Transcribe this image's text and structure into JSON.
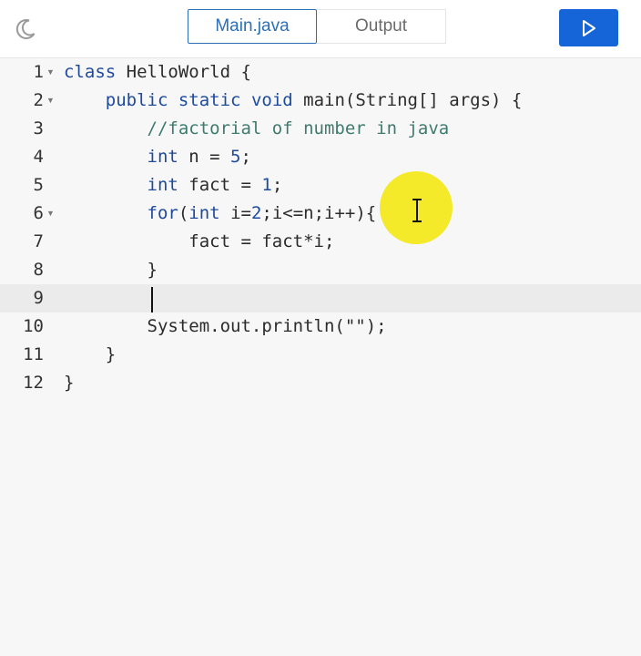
{
  "toolbar": {
    "theme_icon": "moon-icon",
    "tabs": [
      {
        "label": "Main.java",
        "active": true
      },
      {
        "label": "Output",
        "active": false
      }
    ],
    "run_icon": "play-icon",
    "accent": "#1565d8"
  },
  "editor": {
    "language": "java",
    "active_line": 9,
    "lines": [
      {
        "n": "1",
        "text": "class HelloWorld {"
      },
      {
        "n": "2",
        "text": "    public static void main(String[] args) {"
      },
      {
        "n": "3",
        "text": "        //factorial of number in java"
      },
      {
        "n": "4",
        "text": "        int n = 5;"
      },
      {
        "n": "5",
        "text": "        int fact = 1;"
      },
      {
        "n": "6",
        "text": "        for(int i=2;i<=n;i++){"
      },
      {
        "n": "7",
        "text": "            fact = fact*i;"
      },
      {
        "n": "8",
        "text": "        }"
      },
      {
        "n": "9",
        "text": "        "
      },
      {
        "n": "10",
        "text": "        System.out.println(\"\");"
      },
      {
        "n": "11",
        "text": "    }"
      },
      {
        "n": "12",
        "text": "}"
      }
    ]
  }
}
